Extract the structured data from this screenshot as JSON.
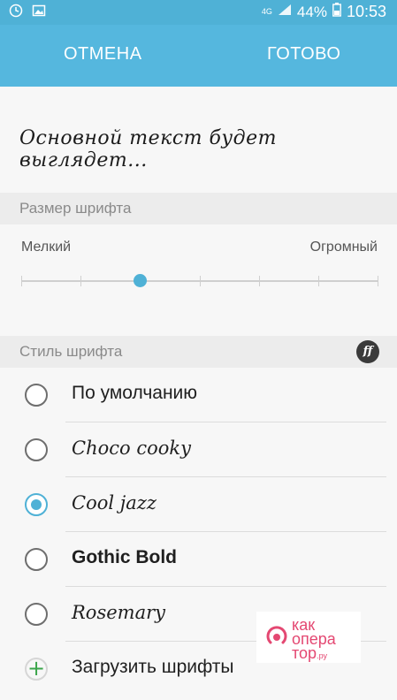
{
  "status_bar": {
    "network": "4G",
    "battery": "44%",
    "clock": "10:53",
    "left_icons": [
      "alarm-icon",
      "image-icon"
    ]
  },
  "action_bar": {
    "cancel_label": "ОТМЕНА",
    "done_label": "ГОТОВО"
  },
  "preview": {
    "text": "Основной текст будет выглядет..."
  },
  "font_size": {
    "header": "Размер шрифта",
    "min_label": "Мелкий",
    "max_label": "Огромный",
    "steps": 7,
    "selected_step": 2
  },
  "font_style": {
    "header": "Стиль шрифта",
    "options": [
      {
        "label": "По умолчанию",
        "selected": false
      },
      {
        "label": "Choco cooky",
        "selected": false
      },
      {
        "label": "Cool jazz",
        "selected": true
      },
      {
        "label": "Gothic Bold",
        "selected": false
      },
      {
        "label": "Rosemary",
        "selected": false
      }
    ],
    "download_label": "Загрузить шрифты"
  },
  "watermark": {
    "line1": "как",
    "line2": "опера",
    "line3": "тор",
    "suffix": ".ру"
  },
  "colors": {
    "accent": "#4fb1d6",
    "plus": "#3aa54a",
    "watermark": "#e44872"
  }
}
